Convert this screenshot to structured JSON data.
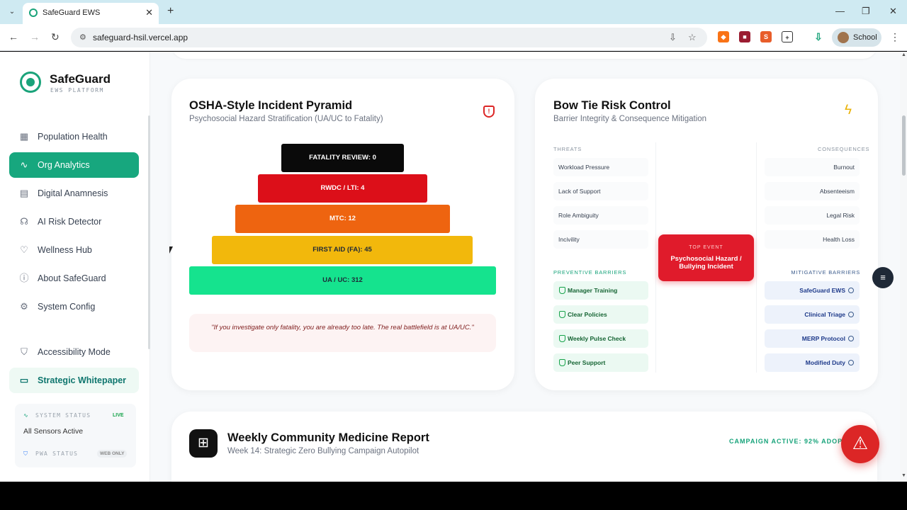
{
  "browser": {
    "tab_title": "SafeGuard EWS",
    "url": "safeguard-hsil.vercel.app",
    "profile_name": "School"
  },
  "sidebar": {
    "brand": "SafeGuard",
    "brand_sub": "EWS PLATFORM",
    "items": [
      {
        "label": "Population Health",
        "icon": "grid-icon"
      },
      {
        "label": "Org Analytics",
        "icon": "activity-icon",
        "active": true
      },
      {
        "label": "Digital Anamnesis",
        "icon": "clipboard-icon"
      },
      {
        "label": "AI Risk Detector",
        "icon": "brain-icon"
      },
      {
        "label": "Wellness Hub",
        "icon": "heart-icon"
      },
      {
        "label": "About SafeGuard",
        "icon": "info-icon"
      },
      {
        "label": "System Config",
        "icon": "gear-icon"
      },
      {
        "label": "Accessibility Mode",
        "icon": "shield-icon"
      },
      {
        "label": "Strategic Whitepaper",
        "icon": "document-icon"
      }
    ],
    "status": {
      "system_label": "SYSTEM STATUS",
      "live": "LIVE",
      "system_value": "All Sensors Active",
      "pwa_label": "PWA STATUS",
      "pwa_value": "WEB ONLY"
    }
  },
  "pyramid_card": {
    "title": "OSHA-Style Incident Pyramid",
    "subtitle": "Psychosocial Hazard Stratification (UA/UC to Fatality)",
    "layers": [
      {
        "label": "FATALITY REVIEW: 0",
        "color": "#0a0a0a"
      },
      {
        "label": "RWDC / LTI: 4",
        "color": "#dc0f19"
      },
      {
        "label": "MTC: 12",
        "color": "#ee6410"
      },
      {
        "label": "FIRST AID (FA): 45",
        "color": "#f2b80c"
      },
      {
        "label": "UA / UC: 312",
        "color": "#15e38e"
      }
    ],
    "quote": "\"If you investigate only fatality, you are already too late. The real battlefield is at UA/UC.\""
  },
  "bowtie_card": {
    "title": "Bow Tie Risk Control",
    "subtitle": "Barrier Integrity & Consequence Mitigation",
    "threats_label": "THREATS",
    "consequences_label": "CONSEQUENCES",
    "threats": [
      "Workload Pressure",
      "Lack of Support",
      "Role Ambiguity",
      "Incivility"
    ],
    "consequences": [
      "Burnout",
      "Absenteeism",
      "Legal Risk",
      "Health Loss"
    ],
    "top_event_label": "TOP EVENT",
    "top_event": "Psychosocial Hazard / Bullying Incident",
    "preventive_label": "PREVENTIVE BARRIERS",
    "mitigative_label": "MITIGATIVE BARRIERS",
    "preventive": [
      "Manager Training",
      "Clear Policies",
      "Weekly Pulse Check",
      "Peer Support"
    ],
    "mitigative": [
      "SafeGuard EWS",
      "Clinical Triage",
      "MERP Protocol",
      "Modified Duty"
    ]
  },
  "report_card": {
    "title": "Weekly Community Medicine Report",
    "subtitle": "Week 14: Strategic Zero Bullying Campaign Autopilot",
    "campaign": "CAMPAIGN ACTIVE: 92% ADOPTI"
  }
}
